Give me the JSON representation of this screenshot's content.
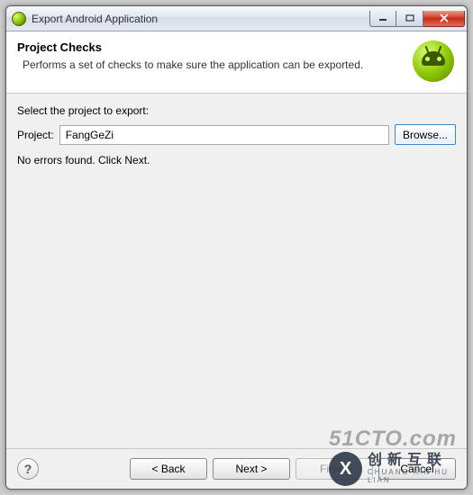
{
  "window": {
    "title": "Export Android Application"
  },
  "header": {
    "title": "Project Checks",
    "description": "Performs a set of checks to make sure the application can be exported."
  },
  "content": {
    "select_label": "Select the project to export:",
    "project_label": "Project:",
    "project_value": "FangGeZi",
    "browse_label": "Browse...",
    "status_message": "No errors found. Click Next."
  },
  "footer": {
    "help": "?",
    "back": "< Back",
    "next": "Next >",
    "finish": "Finish",
    "cancel": "Cancel"
  },
  "watermark": {
    "top": "51CTO.com",
    "logo": "X",
    "cn": "创新互联",
    "en": "CHUANG XIN HU LIAN"
  }
}
